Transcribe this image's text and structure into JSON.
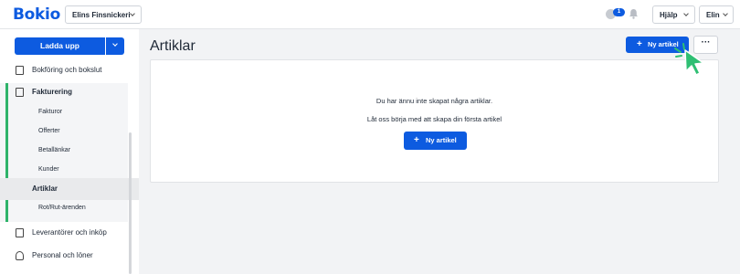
{
  "app": {
    "logo": "Bokio",
    "company": "Elins Finsnickeri",
    "notification_count": "1",
    "help_label": "Hjälp",
    "user_label": "Elin"
  },
  "sidebar": {
    "upload_label": "Ladda upp",
    "items": [
      {
        "label": "Bokföring och bokslut",
        "icon": "book-icon"
      },
      {
        "label": "Fakturering",
        "icon": "invoice-icon"
      },
      {
        "label": "Leverantörer och inköp",
        "icon": "supplier-icon"
      },
      {
        "label": "Personal och löner",
        "icon": "person-icon"
      }
    ],
    "subitems": [
      "Fakturor",
      "Offerter",
      "Betallänkar",
      "Kunder",
      "Artiklar",
      "Rot/Rut-ärenden"
    ],
    "active_subitem": "Artiklar"
  },
  "main": {
    "title": "Artiklar",
    "new_article_label": "Ny artikel",
    "more_label": "···",
    "empty_line1": "Du har ännu inte skapat några artiklar.",
    "empty_line2": "Låt oss börja med att skapa din första artikel",
    "center_button_label": "Ny artikel"
  },
  "colors": {
    "brand_blue": "#0d5be0",
    "accent_green": "#2fb36a",
    "cursor_green": "#2fbf73"
  }
}
